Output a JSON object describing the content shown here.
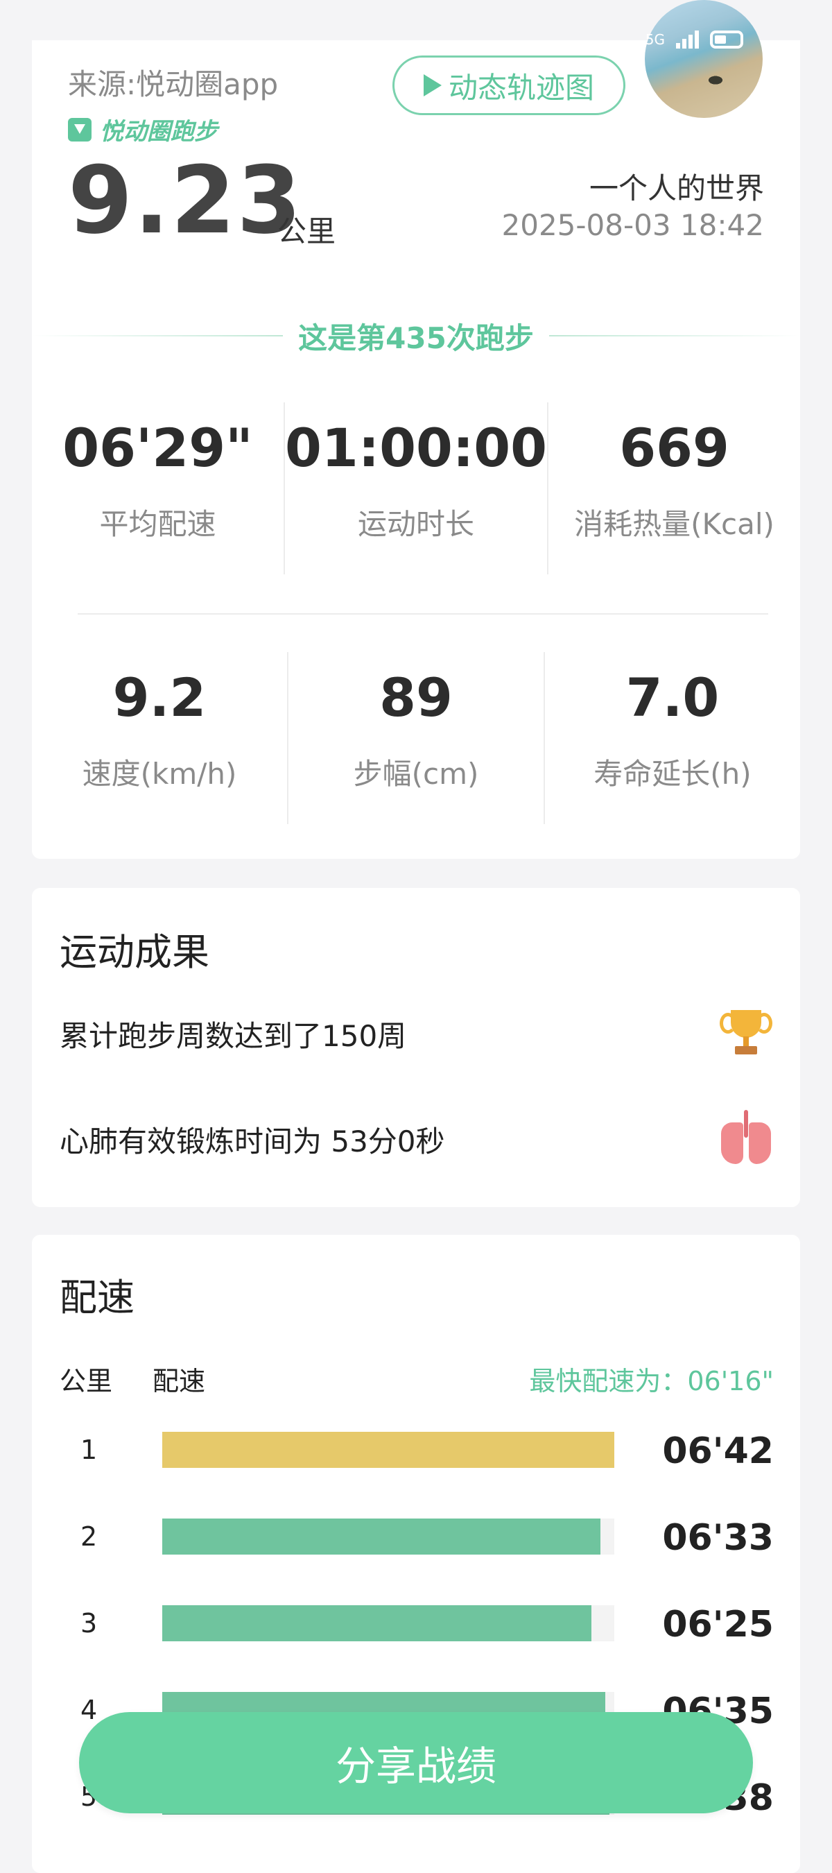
{
  "status_bar": {
    "network": "5G"
  },
  "summary": {
    "source": "来源:悦动圈app",
    "brand": "悦动圈跑步",
    "track_button": "动态轨迹图",
    "distance": "9.23",
    "distance_unit": "公里",
    "nickname": "一个人的世界",
    "datetime": "2025-08-03 18:42",
    "run_count_text": "这是第435次跑步",
    "stats": [
      {
        "value": "06'29\"",
        "label": "平均配速"
      },
      {
        "value": "01:00:00",
        "label": "运动时长"
      },
      {
        "value": "669",
        "label": "消耗热量(Kcal)"
      },
      {
        "value": "9.2",
        "label": "速度(km/h)"
      },
      {
        "value": "89",
        "label": "步幅(cm)"
      },
      {
        "value": "7.0",
        "label": "寿命延长(h)"
      }
    ]
  },
  "achievements": {
    "title": "运动成果",
    "items": [
      {
        "text": "累计跑步周数达到了150周",
        "icon": "trophy-icon"
      },
      {
        "text": "心肺有效锻炼时间为 53分0秒",
        "icon": "lungs-icon"
      }
    ]
  },
  "pace": {
    "title": "配速",
    "col_km": "公里",
    "col_pace": "配速",
    "fastest": "最快配速为：06'16\"",
    "colors": {
      "slowest": "#e6c96a",
      "normal": "#6fc49e"
    },
    "rows": [
      {
        "km": "1",
        "time": "06'42",
        "fraction": 1.0,
        "slowest": true
      },
      {
        "km": "2",
        "time": "06'33",
        "fraction": 0.97
      },
      {
        "km": "3",
        "time": "06'25",
        "fraction": 0.95
      },
      {
        "km": "4",
        "time": "06'35",
        "fraction": 0.98
      },
      {
        "km": "5",
        "time": "06'38",
        "fraction": 0.99
      }
    ]
  },
  "share_button": "分享战绩"
}
